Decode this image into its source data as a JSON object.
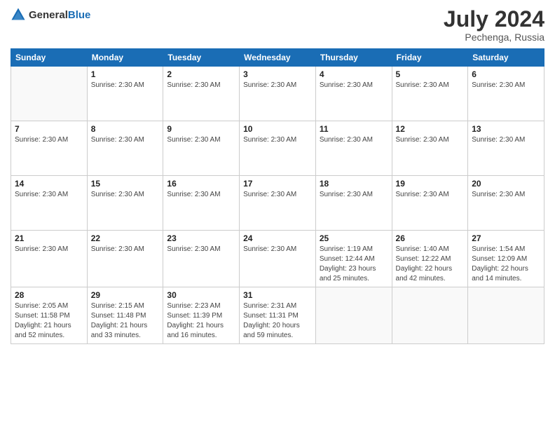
{
  "header": {
    "logo_line1": "General",
    "logo_line2": "Blue",
    "month_year": "July 2024",
    "location": "Pechenga, Russia"
  },
  "weekdays": [
    "Sunday",
    "Monday",
    "Tuesday",
    "Wednesday",
    "Thursday",
    "Friday",
    "Saturday"
  ],
  "weeks": [
    [
      {
        "day": null,
        "info": []
      },
      {
        "day": "1",
        "info": [
          "Sunrise: 2:30 AM"
        ]
      },
      {
        "day": "2",
        "info": [
          "Sunrise: 2:30 AM"
        ]
      },
      {
        "day": "3",
        "info": [
          "Sunrise: 2:30 AM"
        ]
      },
      {
        "day": "4",
        "info": [
          "Sunrise: 2:30 AM"
        ]
      },
      {
        "day": "5",
        "info": [
          "Sunrise: 2:30 AM"
        ]
      },
      {
        "day": "6",
        "info": [
          "Sunrise: 2:30 AM"
        ]
      }
    ],
    [
      {
        "day": "7",
        "info": [
          "Sunrise: 2:30 AM"
        ]
      },
      {
        "day": "8",
        "info": [
          "Sunrise: 2:30 AM"
        ]
      },
      {
        "day": "9",
        "info": [
          "Sunrise: 2:30 AM"
        ]
      },
      {
        "day": "10",
        "info": [
          "Sunrise: 2:30 AM"
        ]
      },
      {
        "day": "11",
        "info": [
          "Sunrise: 2:30 AM"
        ]
      },
      {
        "day": "12",
        "info": [
          "Sunrise: 2:30 AM"
        ]
      },
      {
        "day": "13",
        "info": [
          "Sunrise: 2:30 AM"
        ]
      }
    ],
    [
      {
        "day": "14",
        "info": [
          "Sunrise: 2:30 AM"
        ]
      },
      {
        "day": "15",
        "info": [
          "Sunrise: 2:30 AM"
        ]
      },
      {
        "day": "16",
        "info": [
          "Sunrise: 2:30 AM"
        ]
      },
      {
        "day": "17",
        "info": [
          "Sunrise: 2:30 AM"
        ]
      },
      {
        "day": "18",
        "info": [
          "Sunrise: 2:30 AM"
        ]
      },
      {
        "day": "19",
        "info": [
          "Sunrise: 2:30 AM"
        ]
      },
      {
        "day": "20",
        "info": [
          "Sunrise: 2:30 AM"
        ]
      }
    ],
    [
      {
        "day": "21",
        "info": [
          "Sunrise: 2:30 AM"
        ]
      },
      {
        "day": "22",
        "info": [
          "Sunrise: 2:30 AM"
        ]
      },
      {
        "day": "23",
        "info": [
          "Sunrise: 2:30 AM"
        ]
      },
      {
        "day": "24",
        "info": [
          "Sunrise: 2:30 AM"
        ]
      },
      {
        "day": "25",
        "info": [
          "Sunrise: 1:19 AM",
          "Sunset: 12:44 AM",
          "Daylight: 23 hours and 25 minutes."
        ]
      },
      {
        "day": "26",
        "info": [
          "Sunrise: 1:40 AM",
          "Sunset: 12:22 AM",
          "Daylight: 22 hours and 42 minutes."
        ]
      },
      {
        "day": "27",
        "info": [
          "Sunrise: 1:54 AM",
          "Sunset: 12:09 AM",
          "Daylight: 22 hours and 14 minutes."
        ]
      }
    ],
    [
      {
        "day": "28",
        "info": [
          "Sunrise: 2:05 AM",
          "Sunset: 11:58 PM",
          "Daylight: 21 hours and 52 minutes."
        ]
      },
      {
        "day": "29",
        "info": [
          "Sunrise: 2:15 AM",
          "Sunset: 11:48 PM",
          "Daylight: 21 hours and 33 minutes."
        ]
      },
      {
        "day": "30",
        "info": [
          "Sunrise: 2:23 AM",
          "Sunset: 11:39 PM",
          "Daylight: 21 hours and 16 minutes."
        ]
      },
      {
        "day": "31",
        "info": [
          "Sunrise: 2:31 AM",
          "Sunset: 11:31 PM",
          "Daylight: 20 hours and 59 minutes."
        ]
      },
      {
        "day": null,
        "info": []
      },
      {
        "day": null,
        "info": []
      },
      {
        "day": null,
        "info": []
      }
    ]
  ]
}
